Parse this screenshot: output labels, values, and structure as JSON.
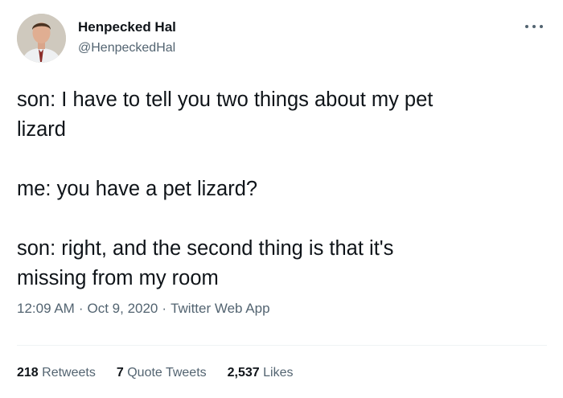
{
  "author": {
    "name": "Henpecked Hal",
    "handle": "@HenpeckedHal"
  },
  "tweet": {
    "paragraphs": [
      [
        "son: I have to tell you two things about my pet",
        "lizard"
      ],
      [
        "me: you have a pet lizard?"
      ],
      [
        "son: right, and the second thing is that it's",
        "missing from my room"
      ]
    ]
  },
  "meta": {
    "time": "12:09 AM",
    "date": "Oct 9, 2020",
    "source": "Twitter Web App",
    "separator": "·"
  },
  "stats": {
    "retweets": {
      "count": "218",
      "label": "Retweets"
    },
    "quotes": {
      "count": "7",
      "label": "Quote Tweets"
    },
    "likes": {
      "count": "2,537",
      "label": "Likes"
    }
  },
  "colors": {
    "text": "#0f1419",
    "secondary": "#536471",
    "divider": "#eff3f4"
  }
}
